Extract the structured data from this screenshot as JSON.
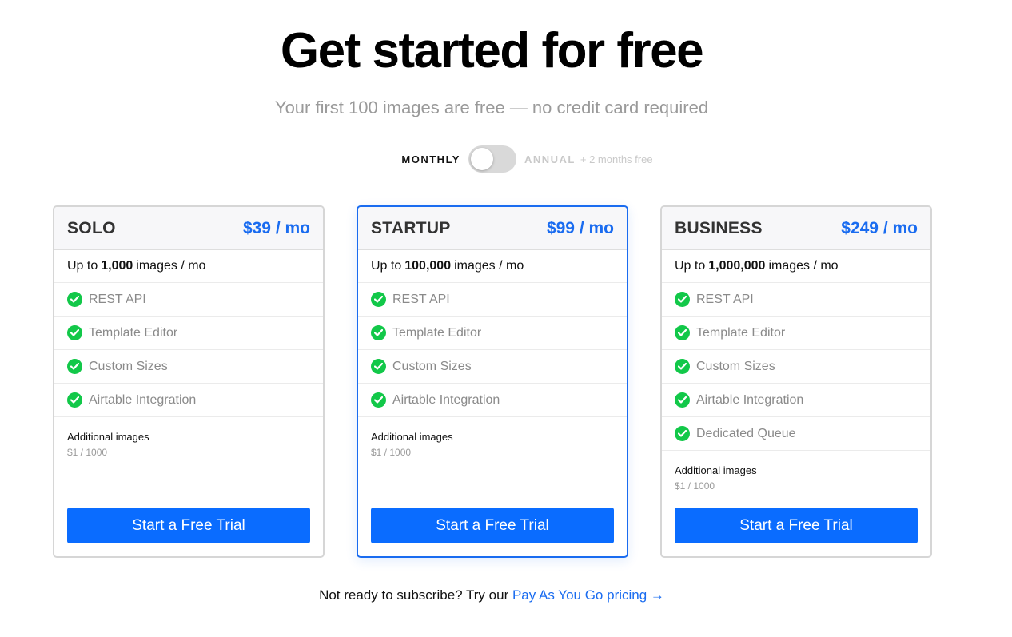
{
  "hero": {
    "title": "Get started for free",
    "subtitle": "Your first 100 images are free — no credit card required"
  },
  "billing": {
    "monthly_label": "MONTHLY",
    "annual_label": "ANNUAL",
    "annual_promo": "+ 2 months free",
    "selected": "monthly"
  },
  "plans": [
    {
      "name": "SOLO",
      "price": "$39 / mo",
      "quota_prefix": "Up to",
      "quota_amount": "1,000",
      "quota_suffix": "images / mo",
      "features": [
        "REST API",
        "Template Editor",
        "Custom Sizes",
        "Airtable Integration"
      ],
      "additional_title": "Additional images",
      "additional_price": "$1 / 1000",
      "cta": "Start a Free Trial",
      "featured": false
    },
    {
      "name": "STARTUP",
      "price": "$99 / mo",
      "quota_prefix": "Up to",
      "quota_amount": "100,000",
      "quota_suffix": "images / mo",
      "features": [
        "REST API",
        "Template Editor",
        "Custom Sizes",
        "Airtable Integration"
      ],
      "additional_title": "Additional images",
      "additional_price": "$1 / 1000",
      "cta": "Start a Free Trial",
      "featured": true
    },
    {
      "name": "BUSINESS",
      "price": "$249 / mo",
      "quota_prefix": "Up to",
      "quota_amount": "1,000,000",
      "quota_suffix": "images / mo",
      "features": [
        "REST API",
        "Template Editor",
        "Custom Sizes",
        "Airtable Integration",
        "Dedicated Queue"
      ],
      "additional_title": "Additional images",
      "additional_price": "$1 / 1000",
      "cta": "Start a Free Trial",
      "featured": false
    }
  ],
  "footer": {
    "text": "Not ready to subscribe? Try our",
    "link_label": "Pay As You Go pricing →"
  },
  "colors": {
    "accent": "#1a6cf0",
    "button": "#0a6cff",
    "check": "#12c849",
    "muted": "#9a9a9a"
  }
}
